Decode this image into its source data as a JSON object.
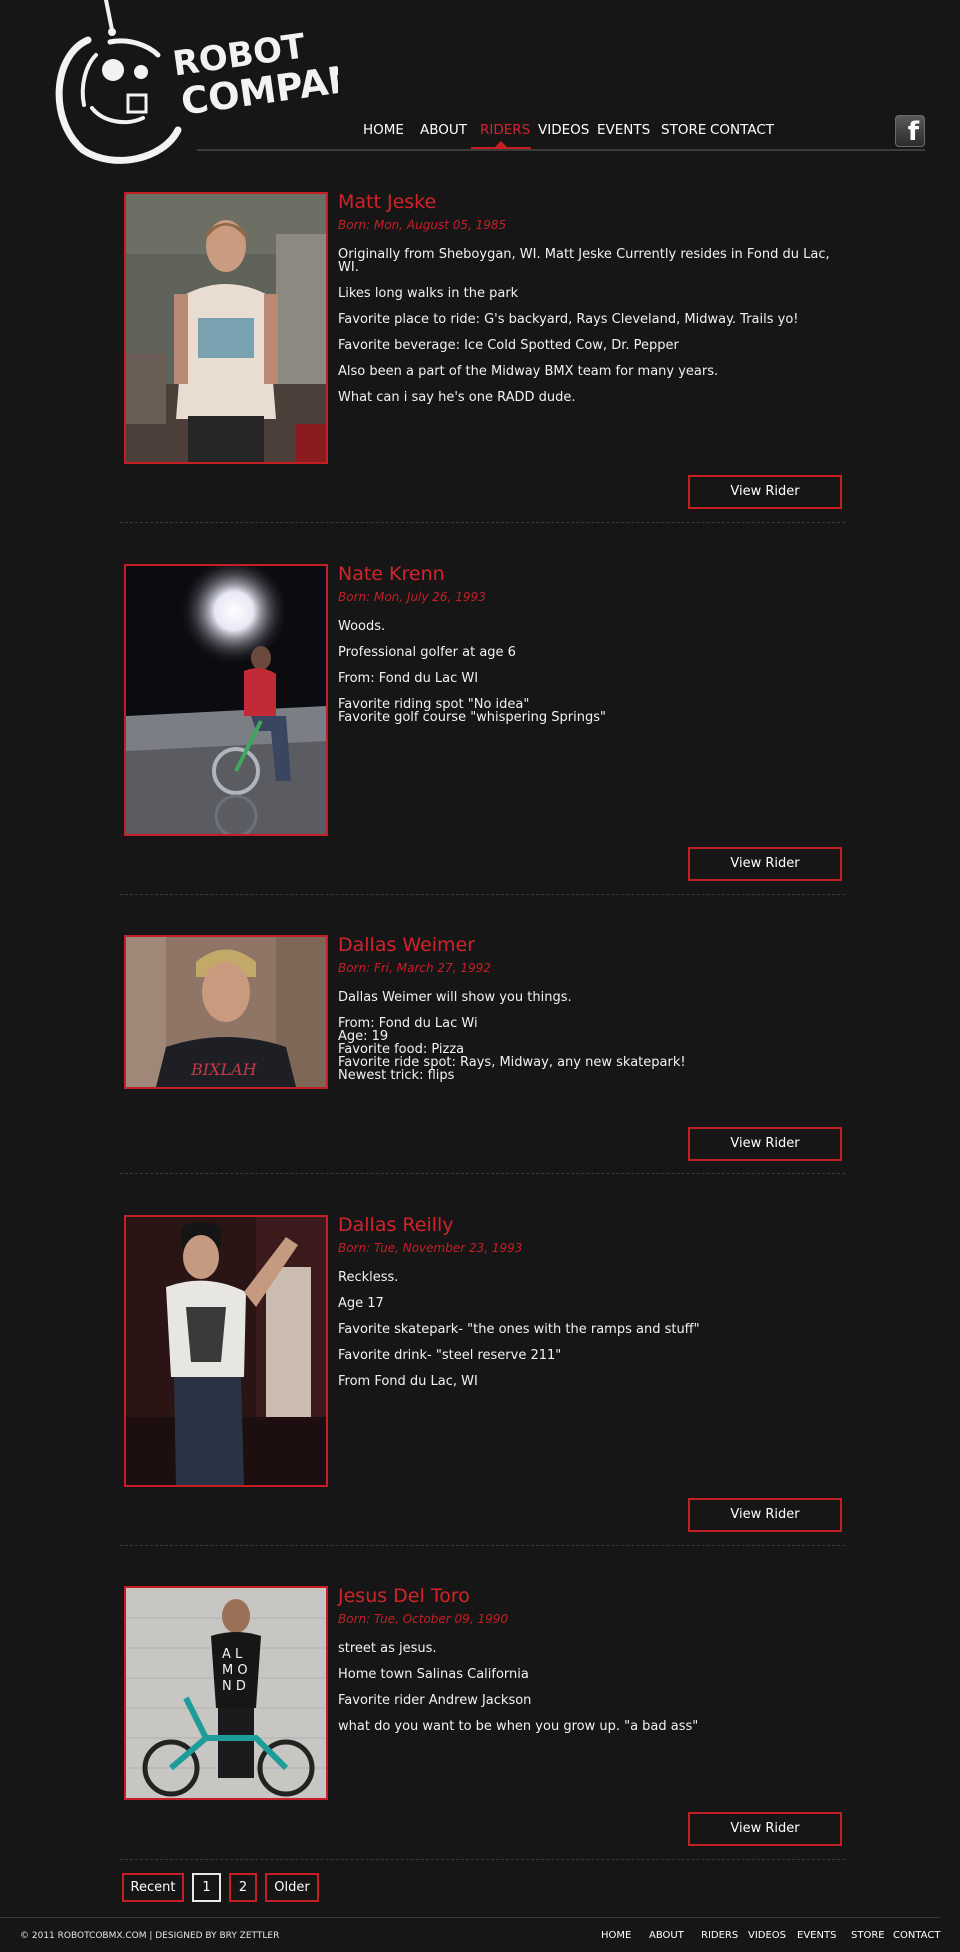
{
  "header": {
    "logo_line1": "ROBOT",
    "logo_line2": "COMPANY",
    "nav": [
      {
        "label": "HOME",
        "active": false
      },
      {
        "label": "ABOUT",
        "active": false
      },
      {
        "label": "RIDERS",
        "active": true
      },
      {
        "label": "VIDEOS",
        "active": false
      },
      {
        "label": "EVENTS",
        "active": false
      },
      {
        "label": "STORE",
        "active": false
      },
      {
        "label": "CONTACT",
        "active": false
      }
    ],
    "facebook_icon": "facebook-icon"
  },
  "riders": [
    {
      "name": "Matt Jeske",
      "born": "Born: Mon, August 05, 1985",
      "bio": [
        "Originally from Sheboygan, WI. Matt Jeske Currently resides in Fond du Lac, WI.",
        "Likes long walks in the park",
        "Favorite place to ride: G's backyard, Rays Cleveland, Midway. Trails yo!",
        "Favorite beverage: Ice Cold Spotted Cow, Dr. Pepper",
        "Also been a part of the Midway BMX team for many years.",
        "What can i say he's one RADD dude."
      ],
      "button": "View Rider"
    },
    {
      "name": "Nate Krenn",
      "born": "Born: Mon, July 26, 1993",
      "bio": [
        "Woods.",
        "Professional golfer at age 6",
        "From: Fond du Lac WI",
        "Favorite riding spot \"No idea\"\nFavorite golf course \"whispering Springs\""
      ],
      "button": "View Rider"
    },
    {
      "name": "Dallas Weimer",
      "born": "Born: Fri, March 27, 1992",
      "bio": [
        "Dallas Weimer will show you things.",
        "From: Fond du Lac Wi\nAge: 19\nFavorite food: Pizza\nFavorite ride spot: Rays, Midway, any new skatepark!\nNewest trick: flips"
      ],
      "button": "View Rider"
    },
    {
      "name": "Dallas Reilly",
      "born": "Born: Tue, November 23, 1993",
      "bio": [
        "Reckless.",
        "Age 17",
        "Favorite skatepark- \"the ones with the ramps and stuff\"",
        "Favorite drink- \"steel reserve 211\"",
        "From Fond du Lac, WI"
      ],
      "button": "View Rider"
    },
    {
      "name": "Jesus Del Toro",
      "born": "Born: Tue, October 09, 1990",
      "bio": [
        "street as jesus.",
        "Home town Salinas California",
        "Favorite rider Andrew Jackson",
        "what do you want to be when you grow up. \"a bad ass\""
      ],
      "button": "View Rider"
    }
  ],
  "pagination": {
    "recent": "Recent",
    "pages": [
      "1",
      "2"
    ],
    "current": "1",
    "older": "Older"
  },
  "footer": {
    "copyright": "© 2011 ROBOTCOBMX.COM | DESIGNED BY BRY ZETTLER",
    "nav": [
      "HOME",
      "ABOUT",
      "RIDERS",
      "VIDEOS",
      "EVENTS",
      "STORE",
      "CONTACT"
    ]
  }
}
